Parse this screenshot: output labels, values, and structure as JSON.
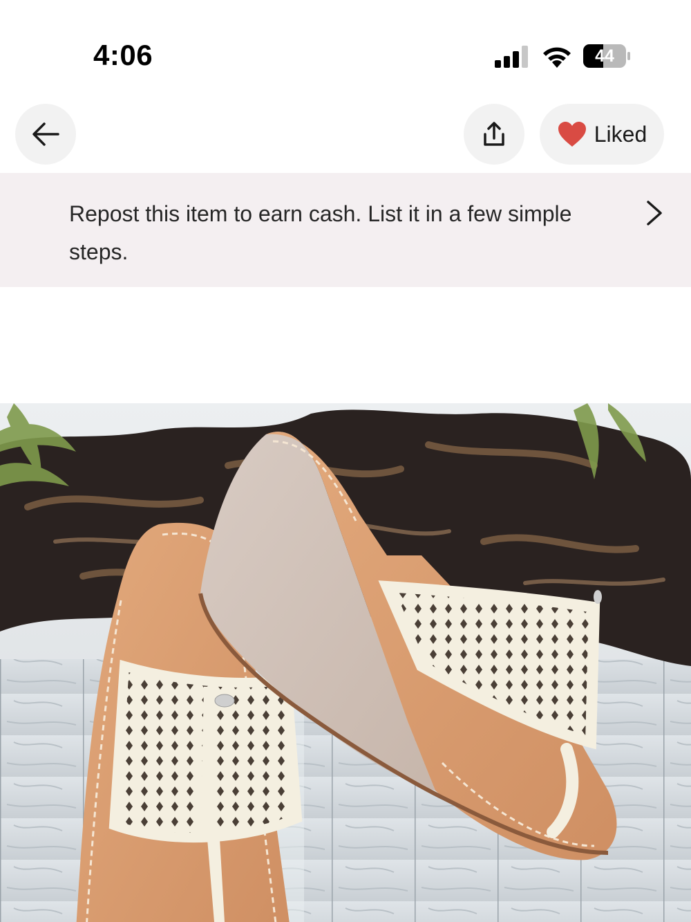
{
  "status_bar": {
    "time": "4:06",
    "battery_level": "44",
    "icons": [
      "signal-icon",
      "wifi-icon",
      "battery-icon"
    ]
  },
  "nav": {
    "back_icon": "arrow-left-icon",
    "share_icon": "share-upload-icon",
    "like_icon": "heart-icon",
    "like_label": "Liked",
    "like_color": "#d94b43"
  },
  "banner": {
    "text": "Repost this item to earn cash. List it in a few simple steps.",
    "chevron_icon": "chevron-right-icon",
    "background": "#f4eff1"
  },
  "product_image": {
    "subject": "cream perforated leather wedge thong sandals on driftwood"
  }
}
